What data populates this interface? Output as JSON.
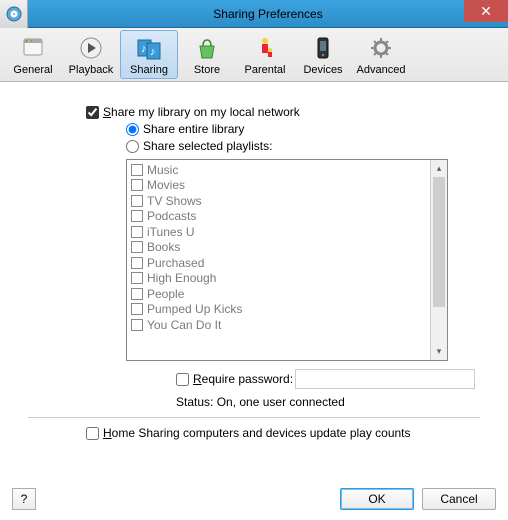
{
  "window": {
    "title": "Sharing Preferences",
    "close": "✕"
  },
  "tabs": [
    {
      "label": "General"
    },
    {
      "label": "Playback"
    },
    {
      "label": "Sharing"
    },
    {
      "label": "Store"
    },
    {
      "label": "Parental"
    },
    {
      "label": "Devices"
    },
    {
      "label": "Advanced"
    }
  ],
  "share_library_label": "Share my library on my local network",
  "share_entire_label": "Share entire library",
  "share_selected_label": "Share selected playlists:",
  "playlists": [
    "Music",
    "Movies",
    "TV Shows",
    "Podcasts",
    "iTunes U",
    "Books",
    "Purchased",
    "High Enough",
    "People",
    "Pumped Up Kicks",
    "You Can Do It"
  ],
  "require_password_label": "Require password:",
  "status_label": "Status: On, one user connected",
  "home_sharing_label": "Home Sharing computers and devices update play counts",
  "buttons": {
    "ok": "OK",
    "cancel": "Cancel",
    "help": "?"
  }
}
